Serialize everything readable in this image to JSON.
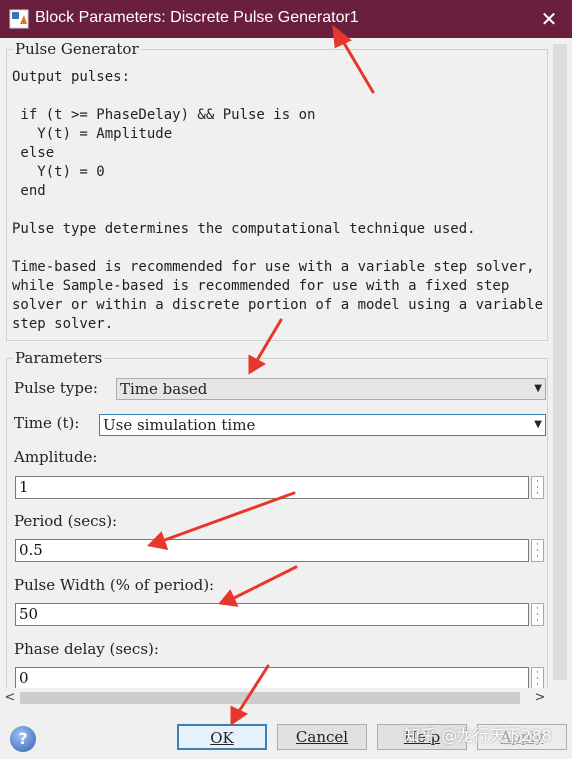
{
  "window": {
    "title": "Block Parameters: Discrete Pulse Generator1",
    "close_label": "✕"
  },
  "description": {
    "legend": "Pulse Generator",
    "lines": [
      "Output pulses:",
      "",
      " if (t >= PhaseDelay) && Pulse is on",
      "   Y(t) = Amplitude",
      " else",
      "   Y(t) = 0",
      " end",
      "",
      "Pulse type determines the computational technique used.",
      "",
      "Time-based is recommended for use with a variable step solver,",
      "while Sample-based is recommended for use with a fixed step",
      "solver or within a discrete portion of a model using a variable",
      "step solver."
    ]
  },
  "parameters": {
    "legend": "Parameters",
    "pulse_type": {
      "label": "Pulse type:",
      "value": "Time based"
    },
    "time": {
      "label": "Time (t):",
      "value": "Use simulation time"
    },
    "amplitude": {
      "label": "Amplitude:",
      "value": "1"
    },
    "period": {
      "label": "Period (secs):",
      "value": "0.5"
    },
    "pulse_width": {
      "label": "Pulse Width (% of period):",
      "value": "50"
    },
    "phase_delay": {
      "label": "Phase delay (secs):",
      "value": "0"
    }
  },
  "buttons": {
    "ok": "OK",
    "cancel": "Cancel",
    "help": "Help",
    "apply": "Apply"
  },
  "watermark": "知乎 @龙行天下288",
  "colors": {
    "titlebar": "#6b1f3f",
    "annotation_arrow": "#e8362c",
    "accent": "#3c7fb1"
  }
}
